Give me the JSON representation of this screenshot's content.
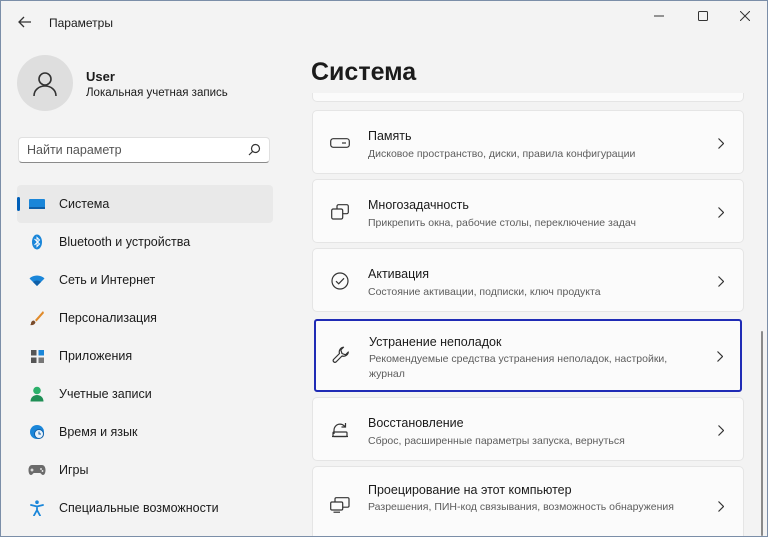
{
  "app": {
    "title": "Параметры"
  },
  "user": {
    "name": "User",
    "account": "Локальная учетная запись"
  },
  "search": {
    "placeholder": "Найти параметр"
  },
  "nav": {
    "items": [
      {
        "label": "Система",
        "icon": "system-icon",
        "selected": true
      },
      {
        "label": "Bluetooth и устройства",
        "icon": "bluetooth-icon"
      },
      {
        "label": "Сеть и Интернет",
        "icon": "wifi-icon"
      },
      {
        "label": "Персонализация",
        "icon": "brush-icon"
      },
      {
        "label": "Приложения",
        "icon": "apps-icon"
      },
      {
        "label": "Учетные записи",
        "icon": "accounts-icon"
      },
      {
        "label": "Время и язык",
        "icon": "time-language-icon"
      },
      {
        "label": "Игры",
        "icon": "gaming-icon"
      },
      {
        "label": "Специальные возможности",
        "icon": "accessibility-icon"
      }
    ]
  },
  "main": {
    "title": "Система",
    "cards": [
      {
        "title": "Память",
        "desc": "Дисковое пространство, диски, правила конфигурации",
        "icon": "storage-icon"
      },
      {
        "title": "Многозадачность",
        "desc": "Прикрепить окна, рабочие столы, переключение задач",
        "icon": "multitasking-icon"
      },
      {
        "title": "Активация",
        "desc": "Состояние активации, подписки, ключ продукта",
        "icon": "activation-icon"
      },
      {
        "title": "Устранение неполадок",
        "desc": "Рекомендуемые средства устранения неполадок, настройки, журнал",
        "icon": "wrench-icon",
        "focused": true
      },
      {
        "title": "Восстановление",
        "desc": "Сброс, расширенные параметры запуска, вернуться",
        "icon": "recovery-icon"
      },
      {
        "title": "Проецирование на этот компьютер",
        "desc": "Разрешения, ПИН-код связывания, возможность обнаружения",
        "icon": "projection-icon"
      }
    ]
  },
  "colors": {
    "accent": "#005fb8",
    "focus_border": "#1f2bb5",
    "window_bg": "#f3f3f3",
    "card_bg": "#fbfbfb"
  }
}
